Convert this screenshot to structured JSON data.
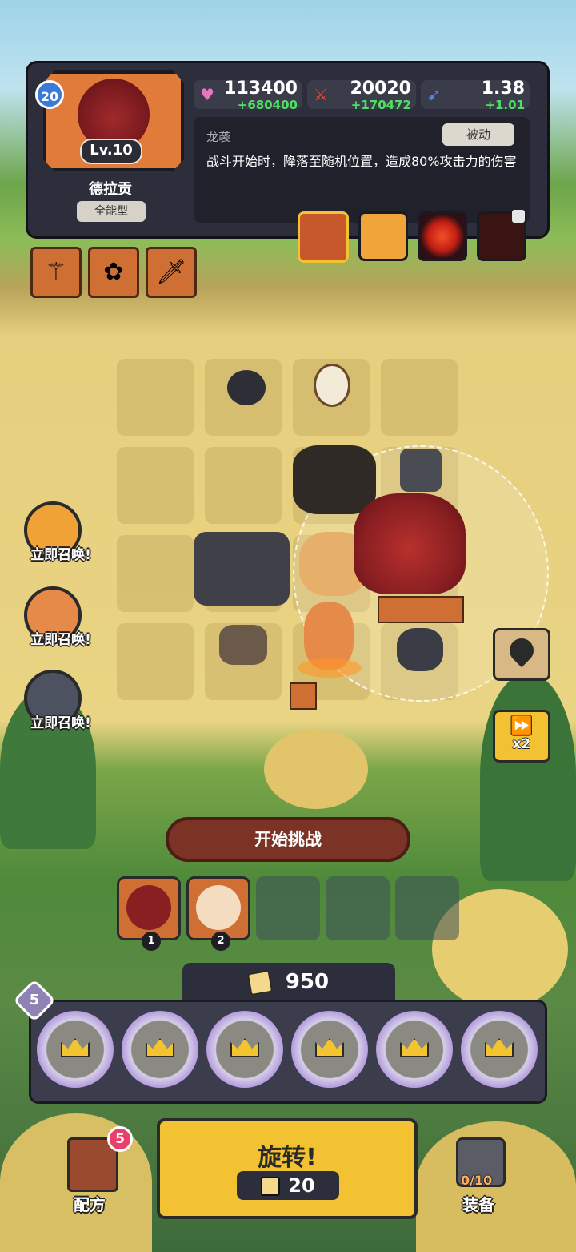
{
  "hero": {
    "level_badge": "20",
    "level": "Lv.10",
    "name": "德拉贡",
    "type": "全能型"
  },
  "stats": [
    {
      "icon": "heart-icon",
      "value": "113400",
      "bonus": "+680400"
    },
    {
      "icon": "sword-icon",
      "value": "20020",
      "bonus": "+170472"
    },
    {
      "icon": "speed-icon",
      "value": "1.38",
      "bonus": "+1.01"
    }
  ],
  "skill": {
    "name": "龙袭",
    "tag": "被动",
    "description": "战斗开始时，降落至随机位置，造成80%攻击力的伤害"
  },
  "summons": [
    {
      "label": "立即召唤!"
    },
    {
      "label": "立即召唤!"
    },
    {
      "label": "立即召唤!"
    }
  ],
  "speed": {
    "label": "x2"
  },
  "start_button": {
    "label": "开始挑战"
  },
  "team_slots": [
    {
      "number": "1"
    },
    {
      "number": "2"
    }
  ],
  "gold": {
    "amount": "950"
  },
  "reel_level": "5",
  "spin": {
    "label": "旋转!",
    "cost": "20"
  },
  "recipe": {
    "label": "配方",
    "badge": "5"
  },
  "equipment": {
    "label": "装备",
    "count": "0/10"
  },
  "colors": {
    "accent": "#f2c232",
    "panel": "#2c2e3b",
    "bonus_green": "#4ee064"
  }
}
